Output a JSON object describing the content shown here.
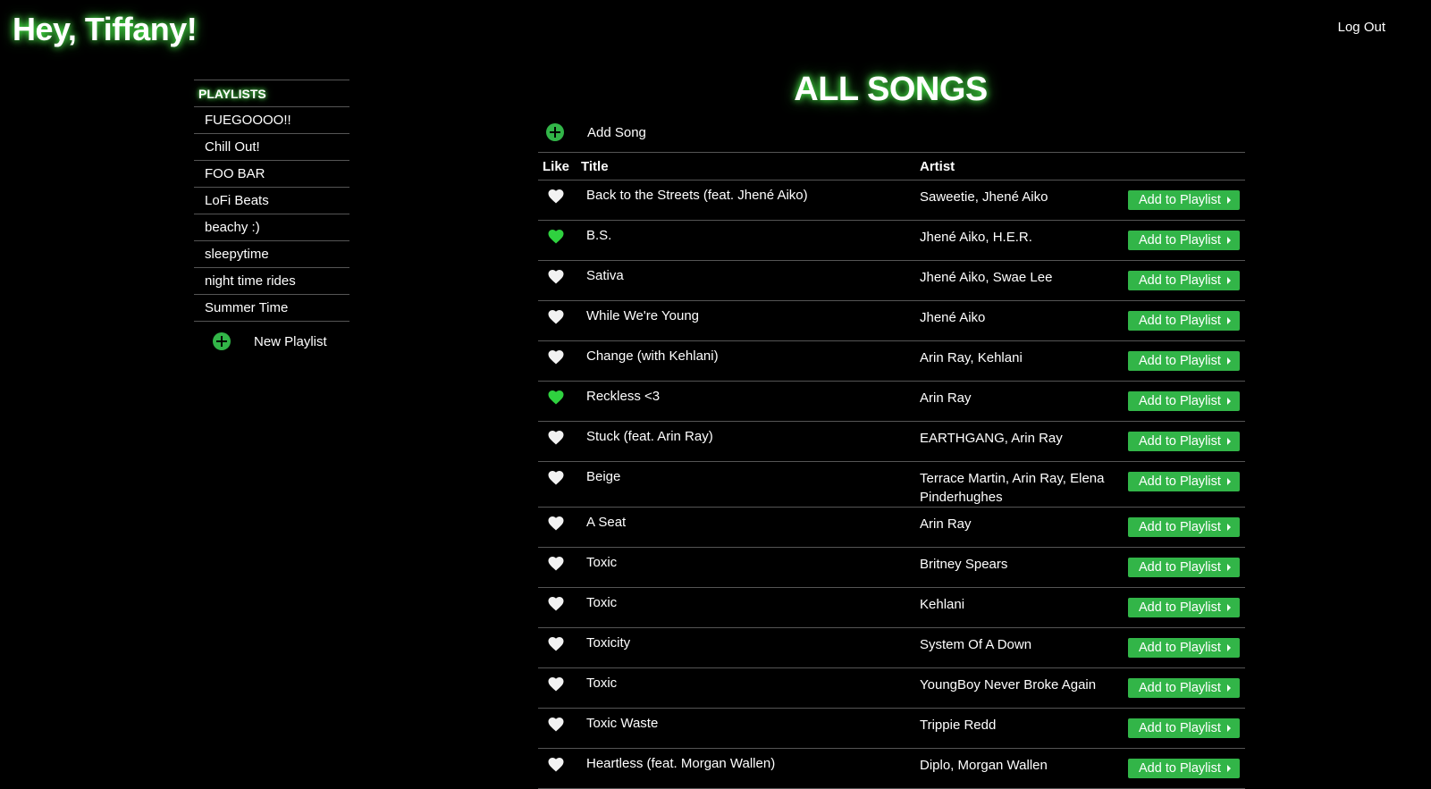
{
  "header": {
    "greeting": "Hey, Tiffany!",
    "logout_label": "Log Out"
  },
  "sidebar": {
    "title": "PLAYLISTS",
    "items": [
      {
        "label": "FUEGOOOO!!"
      },
      {
        "label": "Chill Out!"
      },
      {
        "label": "FOO BAR"
      },
      {
        "label": "LoFi Beats"
      },
      {
        "label": "beachy :)"
      },
      {
        "label": "sleepytime"
      },
      {
        "label": "night time rides"
      },
      {
        "label": "Summer Time"
      }
    ],
    "new_playlist_label": "New Playlist"
  },
  "main": {
    "title": "ALL SONGS",
    "add_song_label": "Add Song",
    "columns": {
      "like": "Like",
      "title": "Title",
      "artist": "Artist"
    },
    "add_to_playlist_label": "Add to Playlist",
    "songs": [
      {
        "title": "Back to the Streets (feat. Jhené Aiko)",
        "artist": "Saweetie, Jhené Aiko",
        "liked": false
      },
      {
        "title": "B.S.",
        "artist": "Jhené Aiko, H.E.R.",
        "liked": true
      },
      {
        "title": "Sativa",
        "artist": "Jhené Aiko, Swae Lee",
        "liked": false
      },
      {
        "title": "While We're Young",
        "artist": "Jhené Aiko",
        "liked": false
      },
      {
        "title": "Change (with Kehlani)",
        "artist": "Arin Ray, Kehlani",
        "liked": false
      },
      {
        "title": "Reckless <3",
        "artist": "Arin Ray",
        "liked": true
      },
      {
        "title": "Stuck (feat. Arin Ray)",
        "artist": "EARTHGANG, Arin Ray",
        "liked": false
      },
      {
        "title": "Beige",
        "artist": "Terrace Martin, Arin Ray, Elena Pinderhughes",
        "liked": false
      },
      {
        "title": "A Seat",
        "artist": "Arin Ray",
        "liked": false
      },
      {
        "title": "Toxic",
        "artist": "Britney Spears",
        "liked": false
      },
      {
        "title": "Toxic",
        "artist": "Kehlani",
        "liked": false
      },
      {
        "title": "Toxicity",
        "artist": "System Of A Down",
        "liked": false
      },
      {
        "title": "Toxic",
        "artist": "YoungBoy Never Broke Again",
        "liked": false
      },
      {
        "title": "Toxic Waste",
        "artist": "Trippie Redd",
        "liked": false
      },
      {
        "title": "Heartless (feat. Morgan Wallen)",
        "artist": "Diplo, Morgan Wallen",
        "liked": false
      }
    ]
  },
  "colors": {
    "accent": "#32b548",
    "liked_heart": "#2fd13f",
    "unliked_heart": "#f2f2f2",
    "glow": "#4dff4d"
  }
}
